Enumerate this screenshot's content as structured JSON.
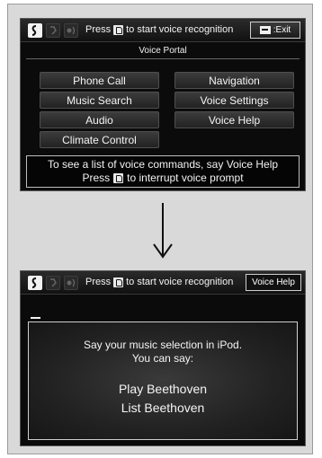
{
  "screen1": {
    "prompt_prefix": "Press",
    "prompt_suffix": "to start voice recognition",
    "exit_label": ":Exit",
    "portal_title": "Voice Portal",
    "menu": [
      "Phone Call",
      "Navigation",
      "Music Search",
      "Voice Settings",
      "Audio",
      "Voice Help",
      "Climate Control"
    ],
    "hint_line1": "To see a list of voice commands, say Voice Help",
    "hint_line2_prefix": "Press",
    "hint_line2_suffix": "to interrupt voice prompt"
  },
  "screen2": {
    "prompt_prefix": "Press",
    "prompt_suffix": "to start voice recognition",
    "voice_help_label": "Voice Help",
    "message_line1": "Say your music selection in iPod.",
    "message_line2": "You can say:",
    "commands": [
      "Play Beethoven",
      "List Beethoven"
    ]
  },
  "icons": [
    "talk-icon",
    "voice-icon",
    "voice-level-icon",
    "back-icon",
    "down-arrow-icon"
  ]
}
